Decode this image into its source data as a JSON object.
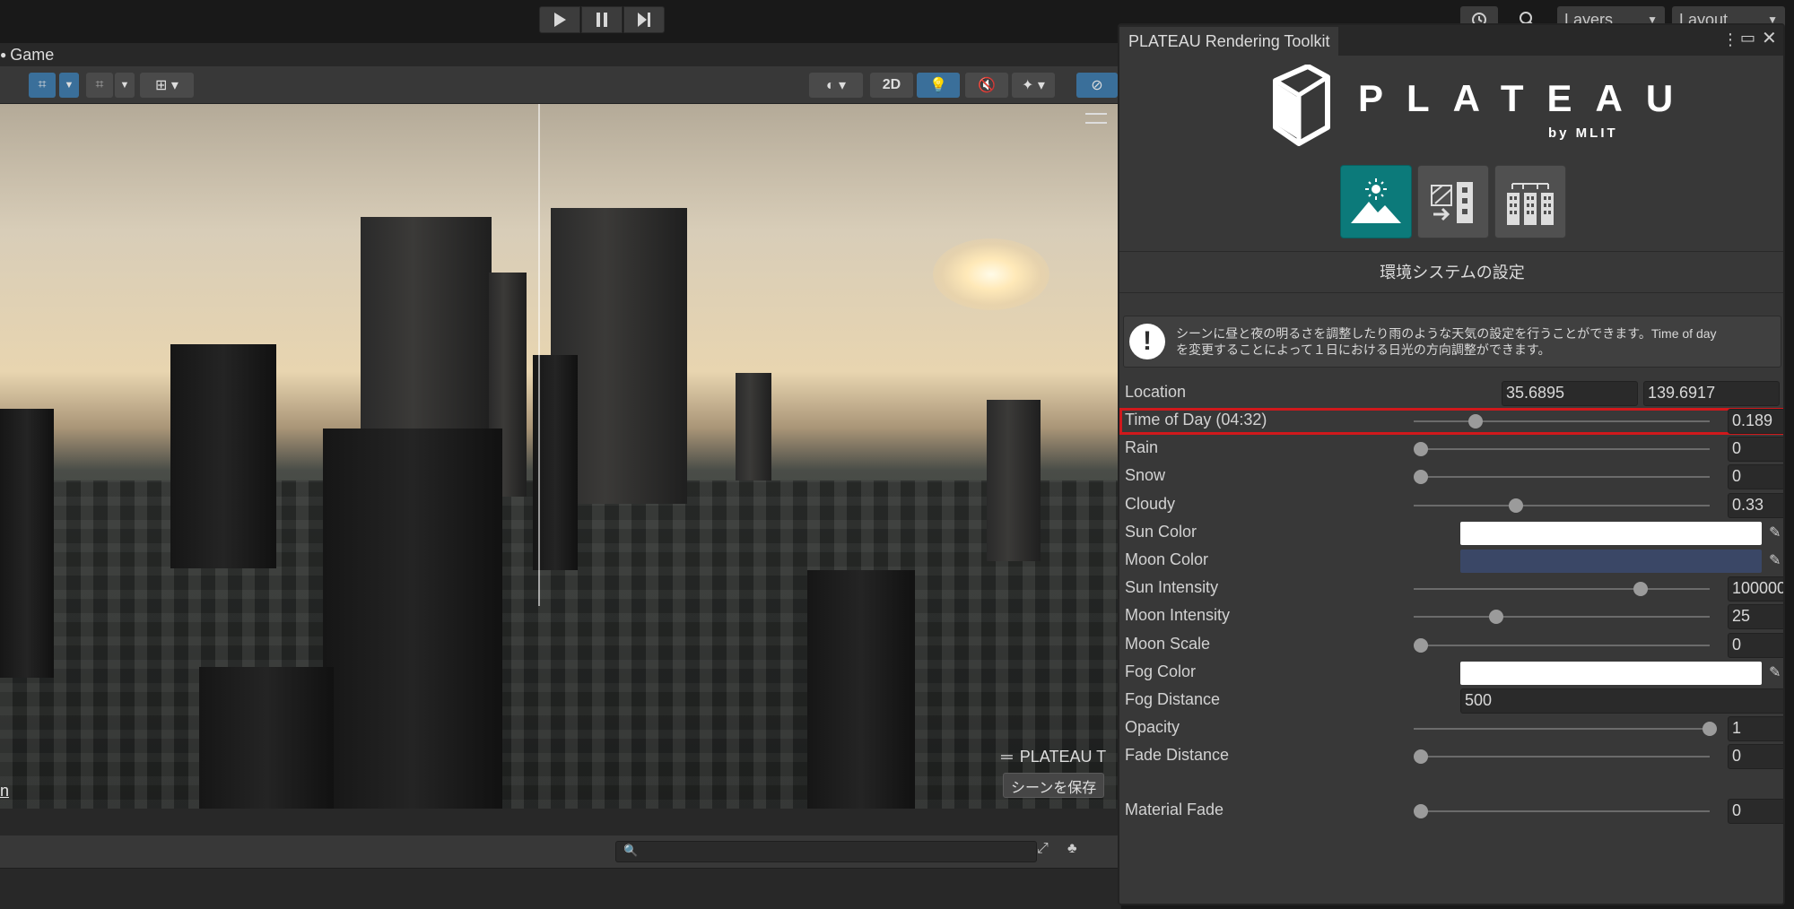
{
  "toolbar": {
    "play_icon": "play-icon",
    "pause_icon": "pause-icon",
    "step_icon": "step-icon",
    "layers_label": "Layers",
    "layout_label": "Layout"
  },
  "game_tab": {
    "label": "Game"
  },
  "game_toolbar": {
    "mode_2d": "2D"
  },
  "viewport": {
    "overlay_title": "PLATEAU T",
    "save_scene_button": "シーンを保存",
    "left_edge_text": "n"
  },
  "panel": {
    "title": "PLATEAU Rendering Toolkit",
    "logo_text": "PLATEAU",
    "logo_sub": "by MLIT",
    "sections": [
      {
        "name": "environment",
        "icon": "mountain-sun-icon",
        "active": true
      },
      {
        "name": "building-texture",
        "icon": "building-arrow-icon",
        "active": false
      },
      {
        "name": "buildings",
        "icon": "city-buildings-icon",
        "active": false
      }
    ],
    "section_title": "環境システムの設定",
    "info_line1": "シーンに昼と夜の明るさを調整したり雨のような天気の設定を行うことができます。Time of day",
    "info_line2": "を変更することによって１日における日光の方向調整ができます。",
    "location": {
      "label": "Location",
      "lat": "35.6895",
      "lon": "139.6917"
    },
    "properties": [
      {
        "label": "Time of Day (04:32)",
        "type": "slider",
        "value": "0.189",
        "fraction": 0.189,
        "highlighted": true
      },
      {
        "label": "Rain",
        "type": "slider",
        "value": "0",
        "fraction": 0
      },
      {
        "label": "Snow",
        "type": "slider",
        "value": "0",
        "fraction": 0
      },
      {
        "label": "Cloudy",
        "type": "slider",
        "value": "0.33",
        "fraction": 0.33
      },
      {
        "label": "Sun Color",
        "type": "color",
        "color": "#ffffff"
      },
      {
        "label": "Moon Color",
        "type": "color",
        "color": "#3a4766"
      },
      {
        "label": "Sun Intensity",
        "type": "slider",
        "value": "100000",
        "fraction": 0.76
      },
      {
        "label": "Moon Intensity",
        "type": "slider",
        "value": "25",
        "fraction": 0.26
      },
      {
        "label": "Moon Scale",
        "type": "slider",
        "value": "0",
        "fraction": 0
      },
      {
        "label": "Fog Color",
        "type": "color",
        "color": "#ffffff"
      },
      {
        "label": "Fog Distance",
        "type": "field",
        "value": "500"
      },
      {
        "label": "Opacity",
        "type": "slider",
        "value": "1",
        "fraction": 1
      },
      {
        "label": "Fade Distance",
        "type": "slider",
        "value": "0",
        "fraction": 0
      }
    ],
    "material_fade": {
      "label": "Material Fade",
      "value": "0",
      "fraction": 0
    }
  },
  "colors": {
    "accent_teal": "#0c7a7a",
    "highlight_red": "#d0191c",
    "editor_bg": "#383838"
  }
}
